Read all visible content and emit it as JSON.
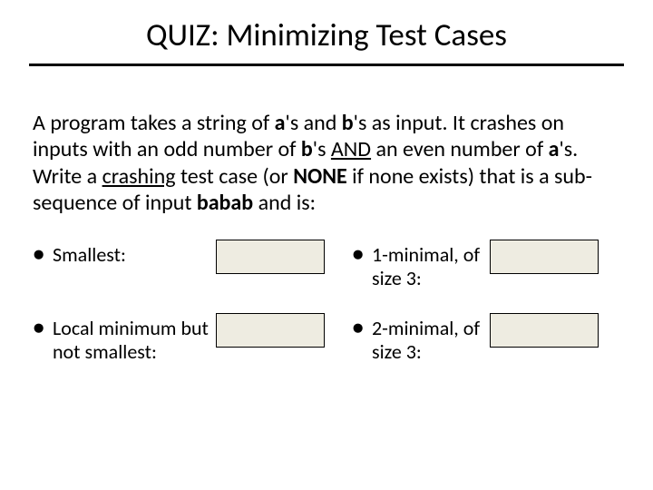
{
  "title": "QUIZ: Minimizing Test Cases",
  "prompt": {
    "p1": "A program takes a string of ",
    "ab1": "a",
    "p2": "'s and ",
    "ab2": "b",
    "p3": "'s as input. It crashes on inputs with an odd number of ",
    "ab3": "b",
    "p4": "'s ",
    "and": "AND",
    "p5": " an even number of ",
    "ab4": "a",
    "p6": "'s. Write a ",
    "crashing": "crashing",
    "p7": " test case (or ",
    "none": "NONE",
    "p8": " if none exists) that is a sub-sequence of input ",
    "babab": "babab",
    "p9": " and is:"
  },
  "bullet": "●",
  "items": [
    {
      "label": "Smallest:"
    },
    {
      "label": "1-minimal, of size 3:"
    },
    {
      "label": "Local minimum but not smallest:"
    },
    {
      "label": "2-minimal, of size 3:"
    }
  ]
}
